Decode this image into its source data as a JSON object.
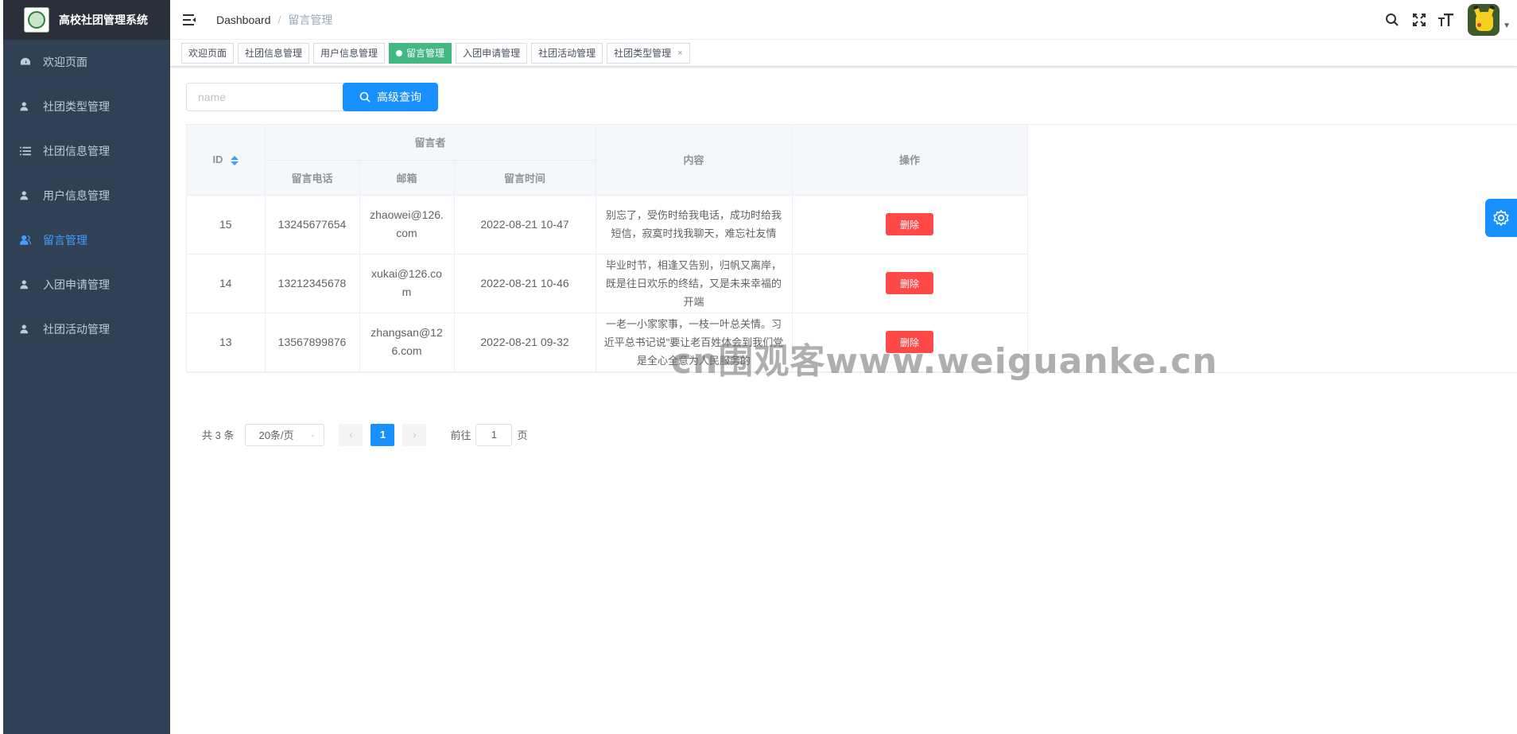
{
  "app": {
    "title": "高校社团管理系统"
  },
  "sidebar": {
    "items": [
      {
        "label": "欢迎页面",
        "icon": "dashboard-icon",
        "active": false
      },
      {
        "label": "社团类型管理",
        "icon": "user-icon",
        "active": false
      },
      {
        "label": "社团信息管理",
        "icon": "list-icon",
        "active": false
      },
      {
        "label": "用户信息管理",
        "icon": "user-icon",
        "active": false
      },
      {
        "label": "留言管理",
        "icon": "user-icon",
        "active": true
      },
      {
        "label": "入团申请管理",
        "icon": "user-icon",
        "active": false
      },
      {
        "label": "社团活动管理",
        "icon": "user-icon",
        "active": false
      }
    ]
  },
  "breadcrumb": {
    "home": "Dashboard",
    "separator": "/",
    "current": "留言管理"
  },
  "tags": [
    {
      "label": "欢迎页面"
    },
    {
      "label": "社团信息管理"
    },
    {
      "label": "用户信息管理"
    },
    {
      "label": "留言管理",
      "active": true
    },
    {
      "label": "入团申请管理"
    },
    {
      "label": "社团活动管理"
    },
    {
      "label": "社团类型管理",
      "close": "×"
    }
  ],
  "search": {
    "placeholder": "name",
    "button": "高级查询"
  },
  "table": {
    "headers": {
      "id": "ID",
      "group": "留言者",
      "phone": "留言电话",
      "email": "邮箱",
      "time": "留言时间",
      "content": "内容",
      "ops": "操作"
    },
    "delete_label": "删除",
    "rows": [
      {
        "id": "15",
        "phone": "13245677654",
        "email": "zhaowei@126.com",
        "time": "2022-08-21 10-47",
        "content": "别忘了，受伤时给我电话，成功时给我短信，寂寞时找我聊天，难忘社友情"
      },
      {
        "id": "14",
        "phone": "13212345678",
        "email": "xukai@126.com",
        "time": "2022-08-21 10-46",
        "content": "毕业时节，相逢又告别，归帆又离岸，既是往日欢乐的终结，又是未来幸福的开端"
      },
      {
        "id": "13",
        "phone": "13567899876",
        "email": "zhangsan@126.com",
        "time": "2022-08-21 09-32",
        "content": "一老一小家家事，一枝一叶总关情。习近平总书记说\"要让老百姓体会到我们党是全心全意为人民服务的"
      }
    ]
  },
  "pagination": {
    "total": "共 3 条",
    "page_size": "20条/页",
    "current_page": "1",
    "jump_prefix": "前往",
    "jump_value": "1",
    "jump_suffix": "页"
  },
  "watermark": "cn围观客www.weiguanke.cn",
  "colors": {
    "sidebar_bg": "#304156",
    "accent": "#1890ff",
    "active_tag": "#42b983",
    "danger": "#ff4949"
  }
}
